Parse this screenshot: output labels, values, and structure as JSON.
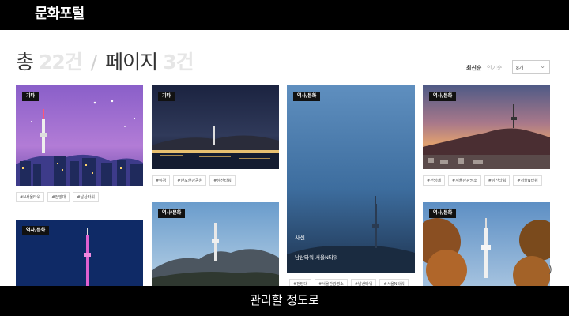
{
  "header": {
    "logo": "문화포털"
  },
  "results": {
    "prefix": "총",
    "total": "22건",
    "divider": "/",
    "page_label": "페이지",
    "page_count": "3건"
  },
  "sort": {
    "latest": "최신순",
    "popular": "인기순",
    "page_size": "8개"
  },
  "cards": [
    {
      "badge": "기타",
      "tags": [
        "#N서울타워",
        "#전망대",
        "#남산타워"
      ]
    },
    {
      "badge": "기타",
      "tags": [
        "#야경",
        "#반포한강공원",
        "#남산타워"
      ]
    },
    {
      "badge": "역사/문화",
      "overlay_title": "사진",
      "overlay_sub": "남산타워 서울N타워",
      "tags": [
        "#전망대",
        "#서울관광명소",
        "#남산타워",
        "#서울N타워"
      ]
    },
    {
      "badge": "역사/문화",
      "tags": [
        "#전망대",
        "#서울관광명소",
        "#남산타워",
        "#서울N타워"
      ]
    },
    {
      "badge": "역사/문화"
    },
    {
      "badge": "역사/문화"
    },
    {
      "badge": "역사/문화"
    }
  ],
  "subtitle": "관리할 정도로",
  "corner_glyph": ")"
}
